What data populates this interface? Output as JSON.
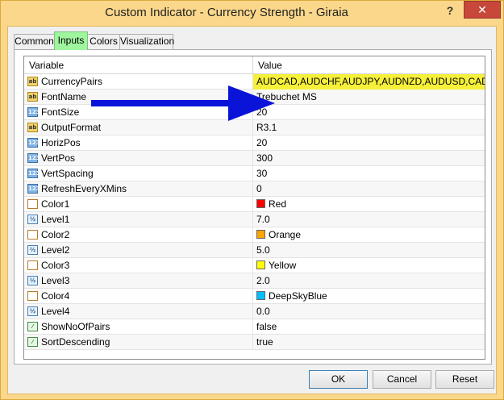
{
  "window": {
    "title": "Custom Indicator - Currency Strength - Giraia",
    "help_label": "?",
    "close_label": "✕"
  },
  "tabs": [
    {
      "label": "Common"
    },
    {
      "label": "Inputs"
    },
    {
      "label": "Colors"
    },
    {
      "label": "Visualization"
    }
  ],
  "active_tab": "Inputs",
  "grid": {
    "headers": {
      "variable": "Variable",
      "value": "Value"
    },
    "rows": [
      {
        "icon": "ab",
        "name": "CurrencyPairs",
        "value": "AUDCAD,AUDCHF,AUDJPY,AUDNZD,AUDUSD,CADCHF..."
      },
      {
        "icon": "ab",
        "name": "FontName",
        "value": "Trebuchet MS"
      },
      {
        "icon": "123",
        "name": "FontSize",
        "value": "20"
      },
      {
        "icon": "ab",
        "name": "OutputFormat",
        "value": "R3.1"
      },
      {
        "icon": "123",
        "name": "HorizPos",
        "value": "20"
      },
      {
        "icon": "123",
        "name": "VertPos",
        "value": "300"
      },
      {
        "icon": "123",
        "name": "VertSpacing",
        "value": "30"
      },
      {
        "icon": "123",
        "name": "RefreshEveryXMins",
        "value": "0"
      },
      {
        "icon": "color",
        "name": "Color1",
        "value": "Red",
        "swatch": "#ff0000"
      },
      {
        "icon": "level",
        "name": "Level1",
        "value": "7.0"
      },
      {
        "icon": "color",
        "name": "Color2",
        "value": "Orange",
        "swatch": "#ffa500"
      },
      {
        "icon": "level",
        "name": "Level2",
        "value": "5.0"
      },
      {
        "icon": "color",
        "name": "Color3",
        "value": "Yellow",
        "swatch": "#ffff00"
      },
      {
        "icon": "level",
        "name": "Level3",
        "value": "2.0"
      },
      {
        "icon": "color",
        "name": "Color4",
        "value": "DeepSkyBlue",
        "swatch": "#00bfff"
      },
      {
        "icon": "level",
        "name": "Level4",
        "value": "0.0"
      },
      {
        "icon": "bool",
        "name": "ShowNoOfPairs",
        "value": "false"
      },
      {
        "icon": "bool",
        "name": "SortDescending",
        "value": "true"
      }
    ]
  },
  "buttons": {
    "ok": "OK",
    "cancel": "Cancel",
    "reset": "Reset"
  },
  "colors": {
    "highlight": "#f6f03a",
    "arrow": "#0a14d8",
    "active_tab": "#9ef59e"
  }
}
